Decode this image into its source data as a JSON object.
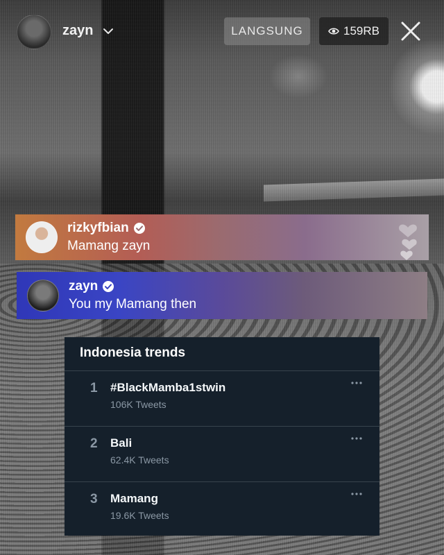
{
  "header": {
    "host_name": "zayn",
    "live_label": "LANGSUNG",
    "viewer_count": "159RB"
  },
  "comments": [
    {
      "username": "rizkyfbian",
      "verified": true,
      "message": "Mamang zayn"
    },
    {
      "username": "zayn",
      "verified": true,
      "message": "You my Mamang then"
    }
  ],
  "trends": {
    "title": "Indonesia trends",
    "items": [
      {
        "rank": "1",
        "name": "#BlackMamba1stwin",
        "count": "106K Tweets"
      },
      {
        "rank": "2",
        "name": "Bali",
        "count": "62.4K Tweets"
      },
      {
        "rank": "3",
        "name": "Mamang",
        "count": "19.6K Tweets"
      }
    ]
  },
  "colors": {
    "verified_badge": "#ffffff",
    "trends_bg": "#15202b",
    "trends_muted": "#8b98a5"
  },
  "icons": [
    "chevron-down-icon",
    "eye-icon",
    "close-icon",
    "verified-icon",
    "hearts-icon",
    "more-icon"
  ]
}
